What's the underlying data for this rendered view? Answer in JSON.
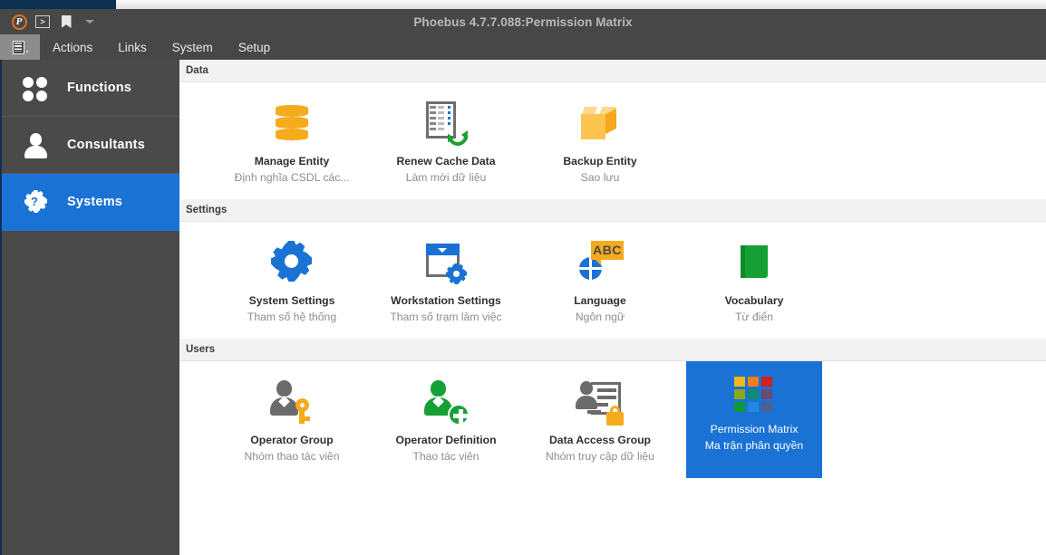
{
  "window": {
    "title": "Phoebus 4.7.7.088:Permission Matrix",
    "accent_color": "#1a72d4",
    "chrome_color": "#474747",
    "sidebar_color": "#4a4a4a",
    "tab_strip_color": "#0e3050"
  },
  "toolbar": {
    "logo_letter": "P",
    "logo_icon": "phoebus-logo-icon",
    "console_label": ">",
    "console_icon": "console-icon",
    "bookmark_icon": "bookmark-icon",
    "overflow_icon": "chevron-down-icon"
  },
  "menubar": {
    "menu_icon": "menu-list-icon",
    "items": [
      {
        "label": "Actions"
      },
      {
        "label": "Links"
      },
      {
        "label": "System"
      },
      {
        "label": "Setup"
      }
    ]
  },
  "sidebar": {
    "items": [
      {
        "label": "Functions",
        "icon": "four-circles-icon",
        "active": false
      },
      {
        "label": "Consultants",
        "icon": "person-icon",
        "active": false
      },
      {
        "label": "Systems",
        "icon": "gear-question-icon",
        "active": true
      }
    ]
  },
  "main": {
    "sections": [
      {
        "header": "Data",
        "tiles": [
          {
            "title": "Manage Entity",
            "subtitle": "Định nghĩa CSDL các...",
            "icon": "database-icon",
            "selected": false
          },
          {
            "title": "Renew Cache Data",
            "subtitle": "Làm mới dữ liệu",
            "icon": "refresh-document-icon",
            "selected": false
          },
          {
            "title": "Backup Entity",
            "subtitle": "Sao lưu",
            "icon": "box-icon",
            "selected": false
          }
        ]
      },
      {
        "header": "Settings",
        "tiles": [
          {
            "title": "System Settings",
            "subtitle": "Tham số hệ thống",
            "icon": "gear-icon",
            "selected": false
          },
          {
            "title": "Workstation Settings",
            "subtitle": "Tham số trạm làm việc",
            "icon": "window-gear-icon",
            "selected": false
          },
          {
            "title": "Language",
            "subtitle": "Ngôn ngữ",
            "icon": "abc-globe-icon",
            "selected": false
          },
          {
            "title": "Vocabulary",
            "subtitle": "Từ điển",
            "icon": "book-icon",
            "selected": false
          }
        ]
      },
      {
        "header": "Users",
        "tiles": [
          {
            "title": "Operator Group",
            "subtitle": "Nhóm thao tác viên",
            "icon": "person-key-icon",
            "selected": false
          },
          {
            "title": "Operator Definition",
            "subtitle": "Thao tác viên",
            "icon": "person-add-icon",
            "selected": false
          },
          {
            "title": "Data Access Group",
            "subtitle": "Nhóm truy cập dữ liệu",
            "icon": "person-lock-icon",
            "selected": false
          },
          {
            "title": "Permission Matrix",
            "subtitle": "Ma trận phân quyền",
            "icon": "color-matrix-icon",
            "selected": true
          }
        ]
      }
    ]
  },
  "matrix_icon_colors": [
    "#f6b61d",
    "#ef7d1a",
    "#d32020",
    "#8aa91e",
    "#0f8a74",
    "#6a4a76",
    "#0f9b33",
    "#1f8ae0",
    "#4d6090"
  ],
  "language_icon_text": "ABC"
}
